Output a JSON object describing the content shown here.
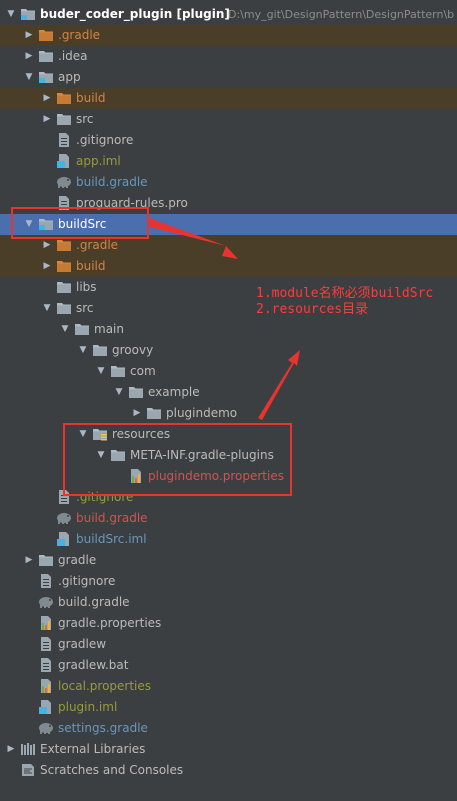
{
  "tree": [
    {
      "label": "buder_coder_plugin [plugin]",
      "path": "D:\\my_git\\DesignPattern\\DesignPattern\\b",
      "icon": "module-folder-icon",
      "arrow": "down",
      "indent": 0,
      "color": "#ffffff",
      "bold": true
    },
    {
      "label": ".gradle",
      "icon": "folder-orange-icon",
      "arrow": "right",
      "indent": 1,
      "color": "#d28445",
      "bg": "excl"
    },
    {
      "label": ".idea",
      "icon": "folder-icon",
      "arrow": "right",
      "indent": 1,
      "color": "#bbbbbb"
    },
    {
      "label": "app",
      "icon": "module-folder-icon",
      "arrow": "down",
      "indent": 1,
      "color": "#bbbbbb"
    },
    {
      "label": "build",
      "icon": "folder-orange-icon",
      "arrow": "right",
      "indent": 2,
      "color": "#d28445",
      "bg": "excl"
    },
    {
      "label": "src",
      "icon": "folder-icon",
      "arrow": "right",
      "indent": 2,
      "color": "#bbbbbb"
    },
    {
      "label": ".gitignore",
      "icon": "file-icon",
      "arrow": "",
      "indent": 2,
      "color": "#bbbbbb"
    },
    {
      "label": "app.iml",
      "icon": "iml-file-icon",
      "arrow": "",
      "indent": 2,
      "color": "#999a3a"
    },
    {
      "label": "build.gradle",
      "icon": "gradle-elephant-icon",
      "arrow": "",
      "indent": 2,
      "color": "#6897bb"
    },
    {
      "label": "proguard-rules.pro",
      "icon": "file-icon",
      "arrow": "",
      "indent": 2,
      "color": "#bbbbbb"
    },
    {
      "label": "buildSrc",
      "icon": "module-folder-icon",
      "arrow": "down",
      "indent": 1,
      "color": "#ffffff",
      "bg": "sel"
    },
    {
      "label": ".gradle",
      "icon": "folder-orange-icon",
      "arrow": "right",
      "indent": 2,
      "color": "#d28445",
      "bg": "excl"
    },
    {
      "label": "build",
      "icon": "folder-orange-icon",
      "arrow": "right",
      "indent": 2,
      "color": "#d28445",
      "bg": "excl"
    },
    {
      "label": "libs",
      "icon": "folder-icon",
      "arrow": "",
      "indent": 2,
      "color": "#bbbbbb"
    },
    {
      "label": "src",
      "icon": "folder-icon",
      "arrow": "down",
      "indent": 2,
      "color": "#bbbbbb"
    },
    {
      "label": "main",
      "icon": "folder-icon",
      "arrow": "down",
      "indent": 3,
      "color": "#bbbbbb"
    },
    {
      "label": "groovy",
      "icon": "folder-icon",
      "arrow": "down",
      "indent": 4,
      "color": "#bbbbbb"
    },
    {
      "label": "com",
      "icon": "folder-icon",
      "arrow": "down",
      "indent": 5,
      "color": "#bbbbbb"
    },
    {
      "label": "example",
      "icon": "folder-icon",
      "arrow": "down",
      "indent": 6,
      "color": "#bbbbbb"
    },
    {
      "label": "plugindemo",
      "icon": "folder-icon",
      "arrow": "right",
      "indent": 7,
      "color": "#bbbbbb"
    },
    {
      "label": "resources",
      "icon": "resources-folder-icon",
      "arrow": "down",
      "indent": 4,
      "color": "#bbbbbb"
    },
    {
      "label": "META-INF.gradle-plugins",
      "icon": "folder-icon",
      "arrow": "down",
      "indent": 5,
      "color": "#bbbbbb"
    },
    {
      "label": "plugindemo.properties",
      "icon": "properties-file-icon",
      "arrow": "",
      "indent": 6,
      "color": "#d25252"
    },
    {
      "label": ".gitignore",
      "icon": "file-icon",
      "arrow": "",
      "indent": 2,
      "color": "#999a3a"
    },
    {
      "label": "build.gradle",
      "icon": "gradle-elephant-icon",
      "arrow": "",
      "indent": 2,
      "color": "#d25252"
    },
    {
      "label": "buildSrc.iml",
      "icon": "iml-file-icon",
      "arrow": "",
      "indent": 2,
      "color": "#6897bb"
    },
    {
      "label": "gradle",
      "icon": "folder-icon",
      "arrow": "right",
      "indent": 1,
      "color": "#bbbbbb"
    },
    {
      "label": ".gitignore",
      "icon": "file-icon",
      "arrow": "",
      "indent": 1,
      "color": "#bbbbbb"
    },
    {
      "label": "build.gradle",
      "icon": "gradle-elephant-icon",
      "arrow": "",
      "indent": 1,
      "color": "#bbbbbb"
    },
    {
      "label": "gradle.properties",
      "icon": "properties-file-icon",
      "arrow": "",
      "indent": 1,
      "color": "#bbbbbb"
    },
    {
      "label": "gradlew",
      "icon": "file-icon",
      "arrow": "",
      "indent": 1,
      "color": "#bbbbbb"
    },
    {
      "label": "gradlew.bat",
      "icon": "file-icon",
      "arrow": "",
      "indent": 1,
      "color": "#bbbbbb"
    },
    {
      "label": "local.properties",
      "icon": "properties-file-icon",
      "arrow": "",
      "indent": 1,
      "color": "#999a3a"
    },
    {
      "label": "plugin.iml",
      "icon": "iml-file-icon",
      "arrow": "",
      "indent": 1,
      "color": "#999a3a"
    },
    {
      "label": "settings.gradle",
      "icon": "gradle-elephant-icon",
      "arrow": "",
      "indent": 1,
      "color": "#6897bb"
    },
    {
      "label": "External Libraries",
      "icon": "libraries-icon",
      "arrow": "right",
      "indent": 0,
      "color": "#bbbbbb"
    },
    {
      "label": "Scratches and Consoles",
      "icon": "scratches-icon",
      "arrow": "",
      "indent": 0,
      "color": "#bbbbbb"
    }
  ],
  "annotation": {
    "line1": "1.module名称必须buildSrc",
    "line2": "2.resources目录"
  },
  "colors": {
    "background": "#3c3f41",
    "selection": "#4b6eaf",
    "excluded": "#4b3e29",
    "annotation_red": "#e8332e"
  }
}
